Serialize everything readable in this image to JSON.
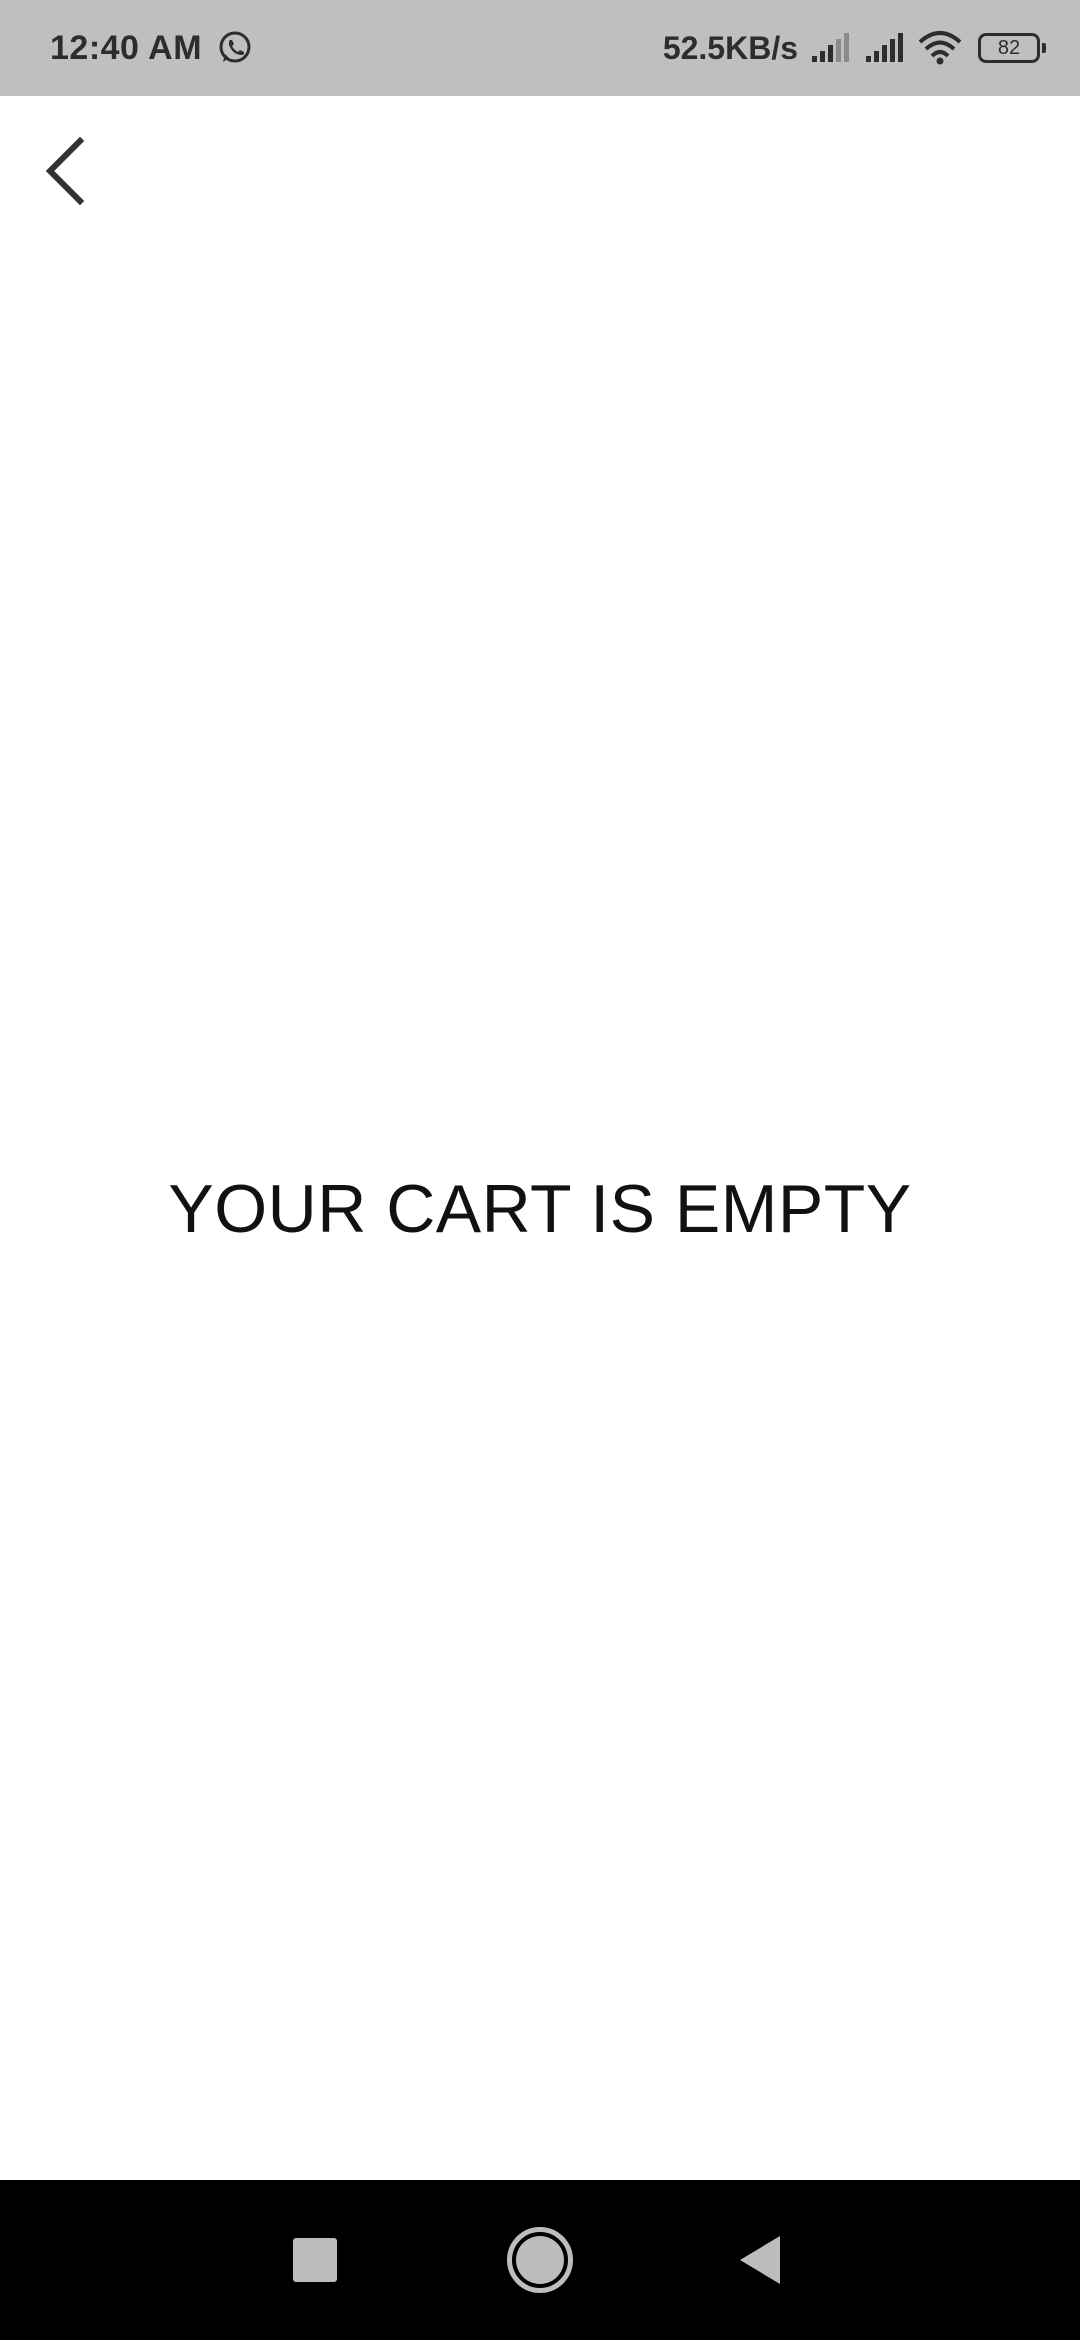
{
  "status_bar": {
    "time": "12:40 AM",
    "network_speed": "52.5KB/s",
    "battery_level": "82",
    "icons": [
      "whatsapp-icon",
      "signal-icon",
      "signal-icon",
      "wifi-icon",
      "battery-icon"
    ]
  },
  "app_bar": {
    "back_icon": "chevron-left-icon"
  },
  "main": {
    "empty_message": "YOUR CART IS EMPTY"
  },
  "nav_bar": {
    "buttons": [
      "recents-icon",
      "home-icon",
      "back-icon"
    ]
  },
  "colors": {
    "status_bar_bg": "#bfbfbf",
    "background": "#ffffff",
    "nav_bar_bg": "#000000",
    "text": "#111111"
  }
}
